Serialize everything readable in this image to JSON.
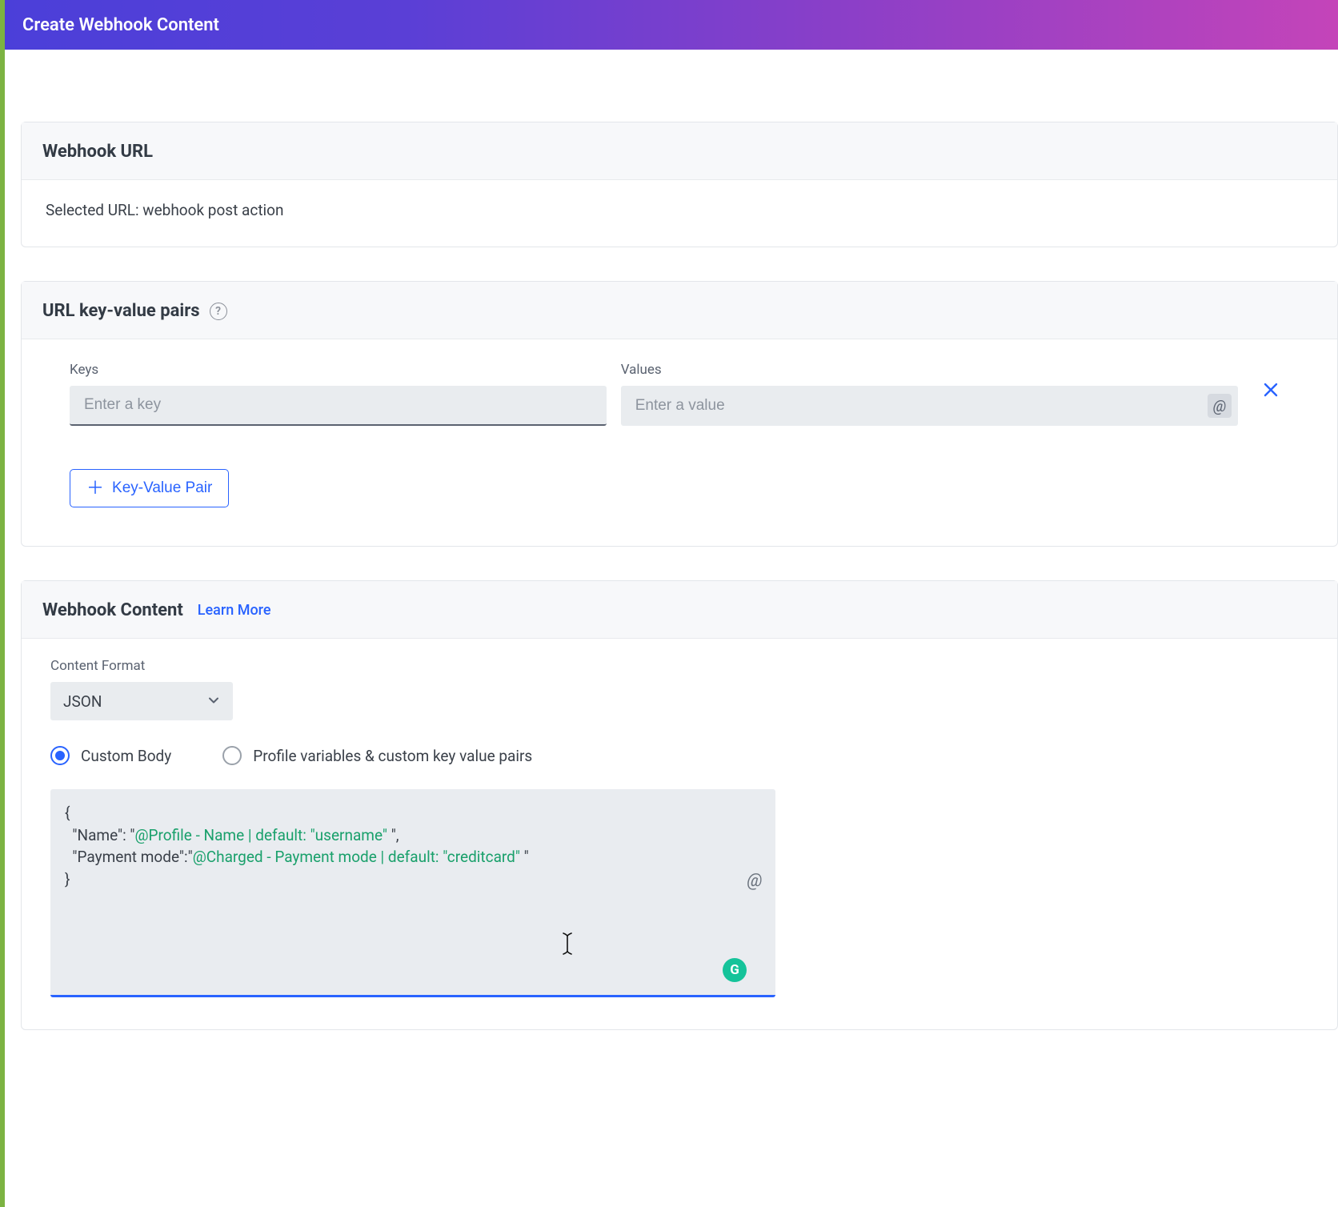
{
  "header": {
    "title": "Create Webhook Content"
  },
  "webhook_url": {
    "title": "Webhook URL",
    "body": "Selected URL: webhook post action"
  },
  "kv": {
    "title": "URL key-value pairs",
    "keys_label": "Keys",
    "values_label": "Values",
    "key_placeholder": "Enter a key",
    "value_placeholder": "Enter a value",
    "at_glyph": "@",
    "add_label": "Key-Value Pair"
  },
  "content": {
    "title": "Webhook Content",
    "learn_more": "Learn More",
    "format_label": "Content Format",
    "format_selected": "JSON",
    "radio_custom": "Custom Body",
    "radio_profile": "Profile variables & custom key value pairs",
    "body_lines": {
      "l1": "{",
      "l2_a": "  \"Name\": \"",
      "l2_b": "@Profile - Name | default: \"username\"",
      "l2_c": " \",",
      "l3_a": "  \"Payment mode\":\"",
      "l3_b": "@Charged - Payment mode | default: \"creditcard\"",
      "l3_c": " \"",
      "l4": "}"
    },
    "grammarly_glyph": "G"
  }
}
